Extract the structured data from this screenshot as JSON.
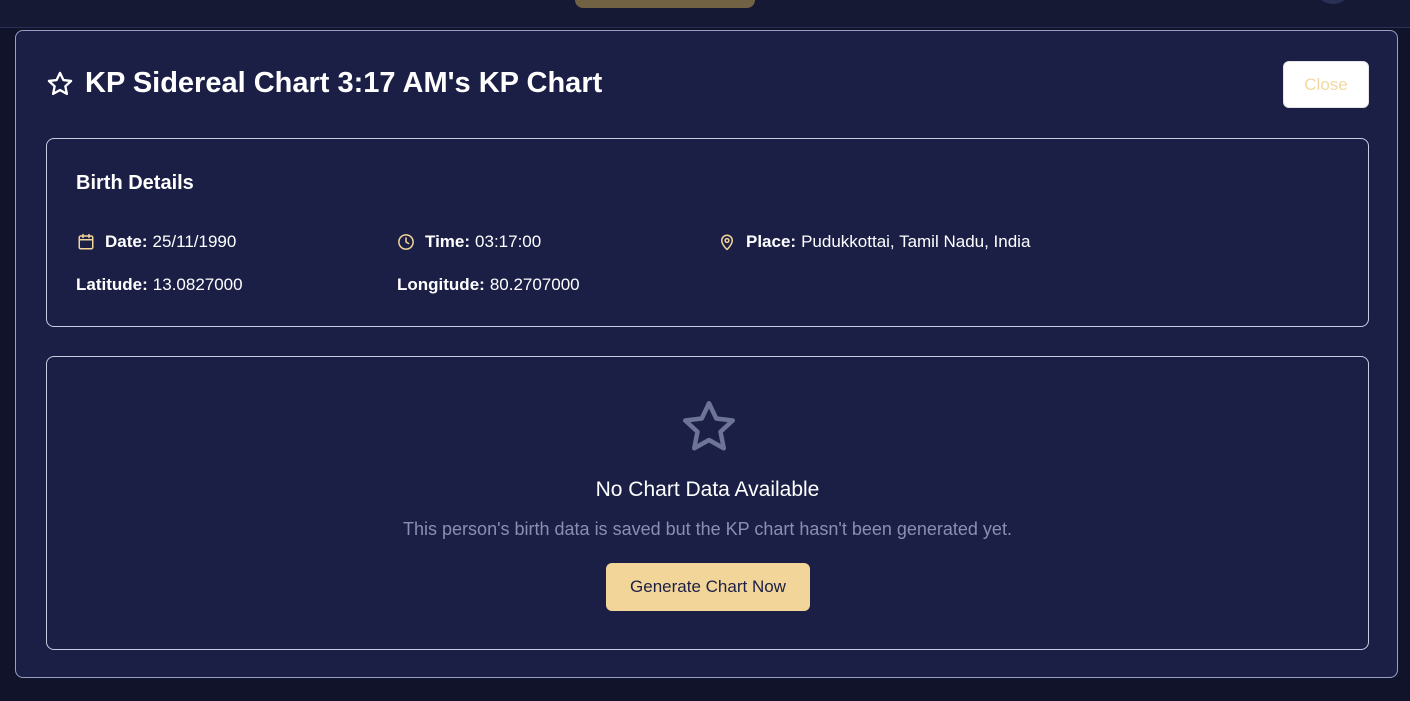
{
  "modal": {
    "title": "KP Sidereal Chart 3:17 AM's KP Chart",
    "close_label": "Close"
  },
  "birth_details": {
    "heading": "Birth Details",
    "date_label": "Date:",
    "date_value": "25/11/1990",
    "time_label": "Time:",
    "time_value": "03:17:00",
    "place_label": "Place:",
    "place_value": "Pudukkottai, Tamil Nadu, India",
    "latitude_label": "Latitude:",
    "latitude_value": "13.0827000",
    "longitude_label": "Longitude:",
    "longitude_value": "80.2707000"
  },
  "empty_state": {
    "title": "No Chart Data Available",
    "description": "This person's birth data is saved but the KP chart hasn't been generated yet.",
    "button_label": "Generate Chart Now"
  },
  "icons": {
    "title": "star-icon",
    "date": "calendar-icon",
    "time": "clock-icon",
    "place": "map-pin-icon",
    "empty": "star-icon"
  },
  "colors": {
    "modal_bg": "#1b1f46",
    "accent": "#f2d599",
    "muted_text": "#8a8fb0"
  }
}
